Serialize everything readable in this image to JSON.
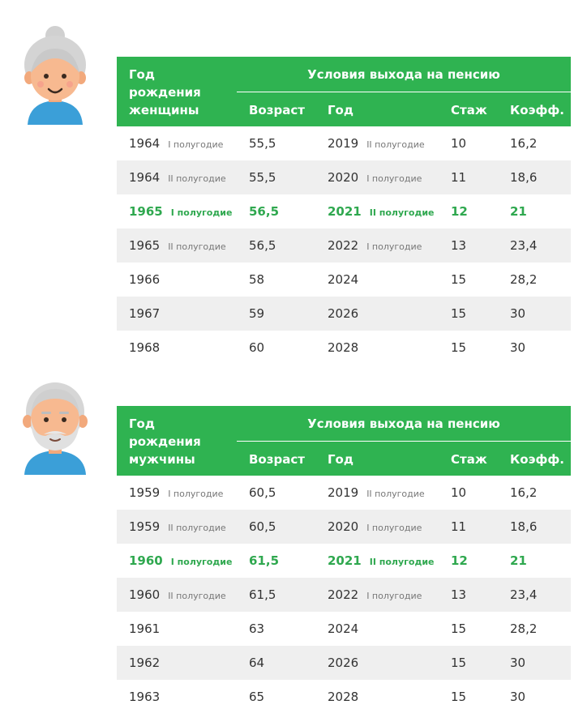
{
  "women": {
    "header": {
      "year_label_1": "Год",
      "year_label_2": "рождения",
      "year_label_3": "женщины",
      "conditions": "Условия выхода на пенсию",
      "col_age": "Возраст",
      "col_year": "Год",
      "col_exp": "Стаж",
      "col_coef": "Коэфф."
    },
    "rows": [
      {
        "birth": "1964",
        "birth_half": "I полугодие",
        "age": "55,5",
        "year": "2019",
        "year_half": "II полугодие",
        "exp": "10",
        "coef": "16,2",
        "highlight": false
      },
      {
        "birth": "1964",
        "birth_half": "II полугодие",
        "age": "55,5",
        "year": "2020",
        "year_half": "I полугодие",
        "exp": "11",
        "coef": "18,6",
        "highlight": false
      },
      {
        "birth": "1965",
        "birth_half": "I полугодие",
        "age": "56,5",
        "year": "2021",
        "year_half": "II полугодие",
        "exp": "12",
        "coef": "21",
        "highlight": true
      },
      {
        "birth": "1965",
        "birth_half": "II полугодие",
        "age": "56,5",
        "year": "2022",
        "year_half": "I полугодие",
        "exp": "13",
        "coef": "23,4",
        "highlight": false
      },
      {
        "birth": "1966",
        "birth_half": "",
        "age": "58",
        "year": "2024",
        "year_half": "",
        "exp": "15",
        "coef": "28,2",
        "highlight": false
      },
      {
        "birth": "1967",
        "birth_half": "",
        "age": "59",
        "year": "2026",
        "year_half": "",
        "exp": "15",
        "coef": "30",
        "highlight": false
      },
      {
        "birth": "1968",
        "birth_half": "",
        "age": "60",
        "year": "2028",
        "year_half": "",
        "exp": "15",
        "coef": "30",
        "highlight": false
      }
    ],
    "colors": {
      "accent": "#2fb351",
      "shade": "#efefef"
    },
    "avatar_icon": "elderly-woman-avatar-icon"
  },
  "men": {
    "header": {
      "year_label_1": "Год",
      "year_label_2": "рождения",
      "year_label_3": "мужчины",
      "conditions": "Условия выхода на пенсию",
      "col_age": "Возраст",
      "col_year": "Год",
      "col_exp": "Стаж",
      "col_coef": "Коэфф."
    },
    "rows": [
      {
        "birth": "1959",
        "birth_half": "I полугодие",
        "age": "60,5",
        "year": "2019",
        "year_half": "II полугодие",
        "exp": "10",
        "coef": "16,2",
        "highlight": false
      },
      {
        "birth": "1959",
        "birth_half": "II полугодие",
        "age": "60,5",
        "year": "2020",
        "year_half": "I полугодие",
        "exp": "11",
        "coef": "18,6",
        "highlight": false
      },
      {
        "birth": "1960",
        "birth_half": "I полугодие",
        "age": "61,5",
        "year": "2021",
        "year_half": "II полугодие",
        "exp": "12",
        "coef": "21",
        "highlight": true
      },
      {
        "birth": "1960",
        "birth_half": "II полугодие",
        "age": "61,5",
        "year": "2022",
        "year_half": "I полугодие",
        "exp": "13",
        "coef": "23,4",
        "highlight": false
      },
      {
        "birth": "1961",
        "birth_half": "",
        "age": "63",
        "year": "2024",
        "year_half": "",
        "exp": "15",
        "coef": "28,2",
        "highlight": false
      },
      {
        "birth": "1962",
        "birth_half": "",
        "age": "64",
        "year": "2026",
        "year_half": "",
        "exp": "15",
        "coef": "30",
        "highlight": false
      },
      {
        "birth": "1963",
        "birth_half": "",
        "age": "65",
        "year": "2028",
        "year_half": "",
        "exp": "15",
        "coef": "30",
        "highlight": false
      }
    ],
    "colors": {
      "accent": "#2fb351",
      "shade": "#efefef"
    },
    "avatar_icon": "elderly-man-avatar-icon"
  }
}
